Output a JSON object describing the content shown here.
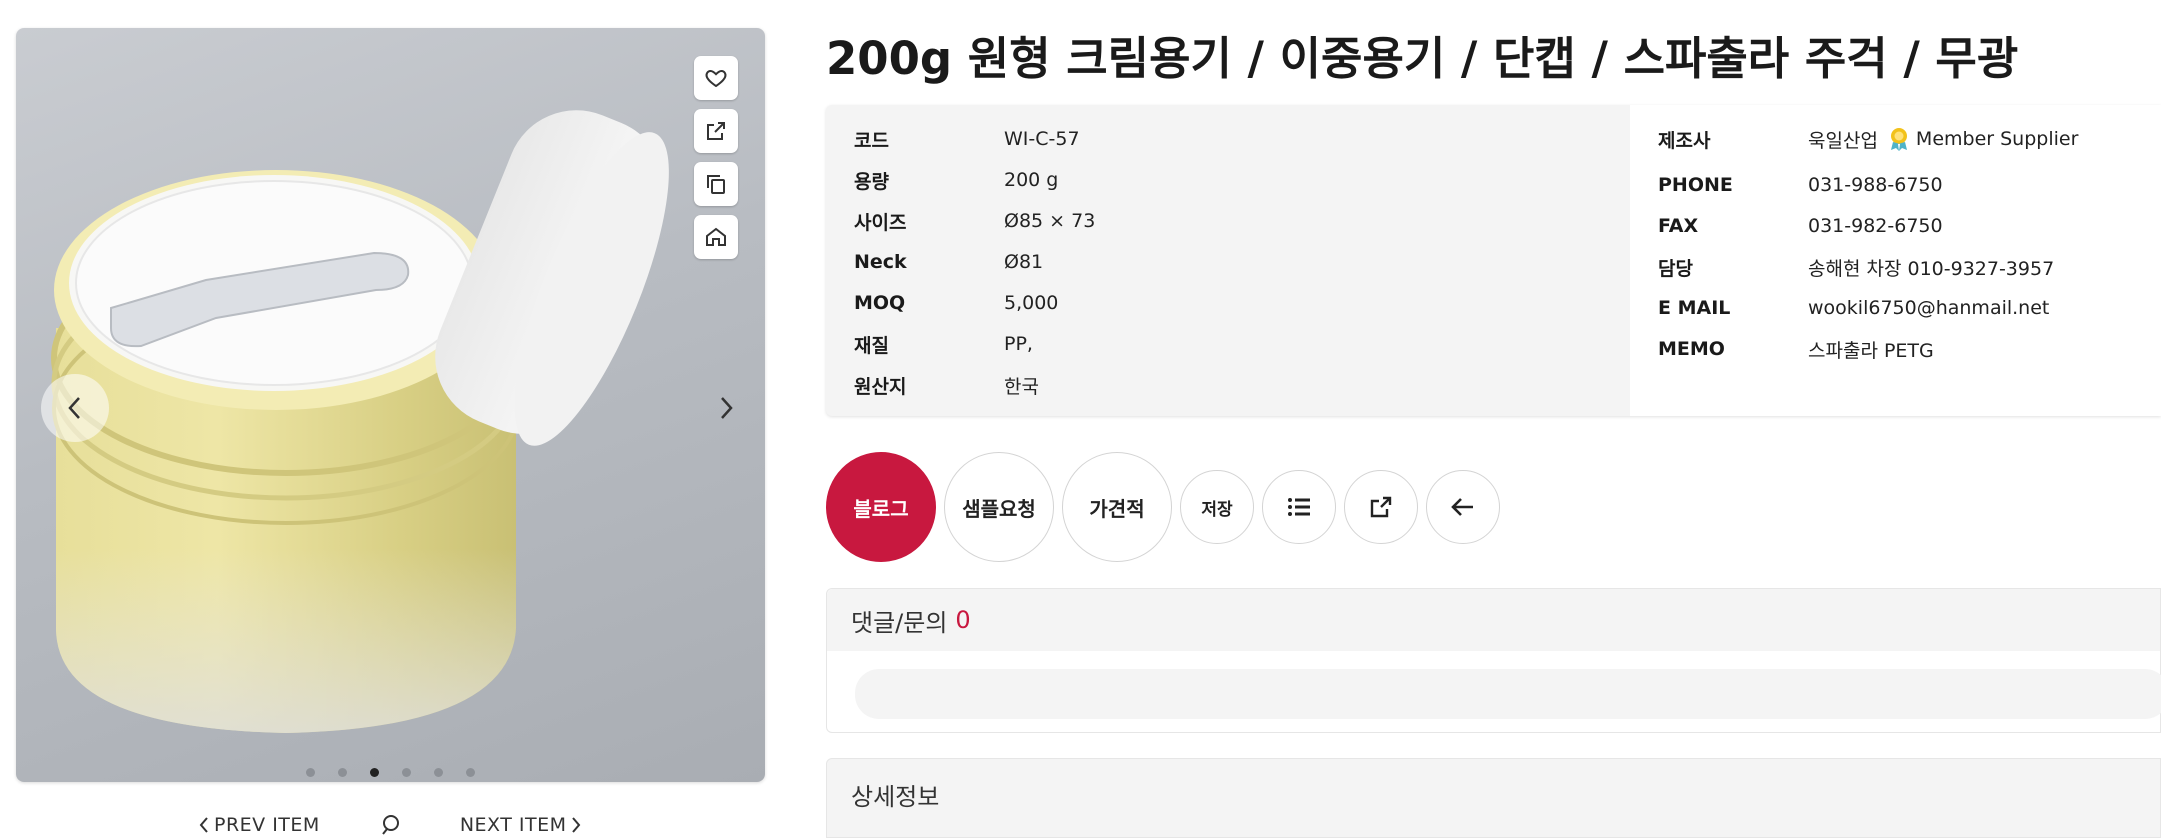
{
  "product": {
    "title": "200g 원형 크림용기 / 이중용기 / 단캡 / 스파출라 주걱 / 무광"
  },
  "gallery": {
    "slide_count": 6,
    "active_index": 2,
    "tools": [
      "heart-icon",
      "share-icon",
      "copy-icon",
      "home-icon"
    ],
    "prev_label": "PREV ITEM",
    "next_label": "NEXT ITEM"
  },
  "specs": [
    {
      "label": "코드",
      "value": "WI-C-57"
    },
    {
      "label": "용량",
      "value": "200 g"
    },
    {
      "label": "사이즈",
      "value": "Ø85 × 73"
    },
    {
      "label": "Neck",
      "value": "Ø81"
    },
    {
      "label": "MOQ",
      "value": "5,000"
    },
    {
      "label": "재질",
      "value": "PP,"
    },
    {
      "label": "원산지",
      "value": "한국"
    }
  ],
  "supplier": {
    "maker_label": "제조사",
    "maker_name": "욱일산업",
    "member_badge": "Member Supplier",
    "phone_label": "PHONE",
    "phone": "031-988-6750",
    "fax_label": "FAX",
    "fax": "031-982-6750",
    "contact_label": "담당",
    "contact": "송해현 차장 010-9327-3957",
    "email_label": "E MAIL",
    "email": "wookil6750@hanmail.net",
    "memo_label": "MEMO",
    "memo": "스파출라 PETG"
  },
  "actions": {
    "blog": "블로그",
    "sample": "샘플요청",
    "quote": "가견적",
    "save": "저장"
  },
  "comments": {
    "title": "댓글/문의",
    "count": "0"
  },
  "detail": {
    "title": "상세정보"
  },
  "colors": {
    "accent": "#c8183f",
    "panel": "#f4f4f4"
  }
}
